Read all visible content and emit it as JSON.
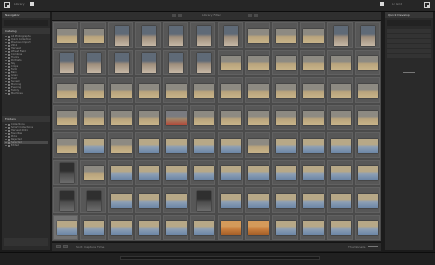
{
  "app": {
    "topbar": {
      "left_label": "Library",
      "right_label": "Lr Grid"
    },
    "filter": {
      "label": "Library Filter"
    },
    "left_panel": {
      "title": "Navigator",
      "catalog_header": "Catalog",
      "folders_header": "Folders",
      "tree": [
        {
          "label": "All Photographs",
          "selected": false
        },
        {
          "label": "Quick Collection",
          "selected": false
        },
        {
          "label": "Previous Import",
          "selected": false
        },
        {
          "label": "2011",
          "selected": false
        },
        {
          "label": "Harvest",
          "selected": false
        },
        {
          "label": "Wheat Field",
          "selected": false
        },
        {
          "label": "Combine",
          "selected": false
        },
        {
          "label": "Trucks",
          "selected": false
        },
        {
          "label": "Portraits",
          "selected": false
        },
        {
          "label": "Sky",
          "selected": false
        },
        {
          "label": "Crops",
          "selected": false
        },
        {
          "label": "Farm",
          "selected": false
        },
        {
          "label": "Barn",
          "selected": false
        },
        {
          "label": "Grain",
          "selected": false
        },
        {
          "label": "Dust",
          "selected": false
        },
        {
          "label": "Sunset",
          "selected": false
        },
        {
          "label": "Morning",
          "selected": false
        },
        {
          "label": "Evening",
          "selected": false
        },
        {
          "label": "Family",
          "selected": false
        },
        {
          "label": "Machines",
          "selected": false
        }
      ],
      "tree2": [
        {
          "label": "Collections",
          "selected": false
        },
        {
          "label": "Smart Collections",
          "selected": false
        },
        {
          "label": "Harvest 2011",
          "selected": false
        },
        {
          "label": "Favorites",
          "selected": false
        },
        {
          "label": "Picks",
          "selected": false
        },
        {
          "label": "Rejected",
          "selected": false
        },
        {
          "label": "Selected",
          "selected": true
        },
        {
          "label": "Edited",
          "selected": false
        }
      ],
      "bottom_buttons": [
        "Import...",
        "Export..."
      ]
    },
    "right_panel": {
      "title": "Quick Develop",
      "rows": 6
    },
    "grid": {
      "columns": 12,
      "rows": 8,
      "thumbs": [
        "wheat",
        "wheat",
        "portrait",
        "portrait",
        "portrait",
        "portrait",
        "portrait",
        "wheat",
        "wheat",
        "wheat",
        "portrait",
        "portrait",
        "portrait",
        "portrait",
        "portrait",
        "portrait",
        "portrait",
        "portrait",
        "wheat",
        "wheat",
        "wheat",
        "wheat",
        "wheat",
        "wheat",
        "wheat",
        "wheat",
        "wheat",
        "wheat",
        "wheat",
        "wheat",
        "wheat",
        "wheat",
        "wheat",
        "wheat",
        "wheat",
        "wheat",
        "wheat",
        "wheat",
        "wheat",
        "wheat",
        "red",
        "wheat",
        "wheat",
        "wheat",
        "wheat",
        "wheat",
        "wheat",
        "wheat",
        "wheat",
        "sky",
        "wheat",
        "sky",
        "sky",
        "sky",
        "sky",
        "wheat",
        "sky",
        "sky",
        "sky",
        "sky",
        "dark",
        "wheat",
        "sky",
        "sky",
        "sky",
        "sky",
        "sky",
        "sky",
        "sky",
        "sky",
        "sky",
        "sky",
        "dark",
        "dark",
        "sky",
        "sky",
        "sky",
        "dark",
        "sky",
        "sky",
        "sky",
        "sky",
        "sky",
        "sky",
        "sky",
        "sky",
        "sky",
        "sky",
        "sky",
        "sky",
        "orange",
        "orange",
        "sky",
        "sky",
        "sky",
        "sky"
      ],
      "selected_index": 84
    },
    "bottom_status": {
      "left": "Sort: Capture Time",
      "right": "Thumbnails"
    }
  }
}
